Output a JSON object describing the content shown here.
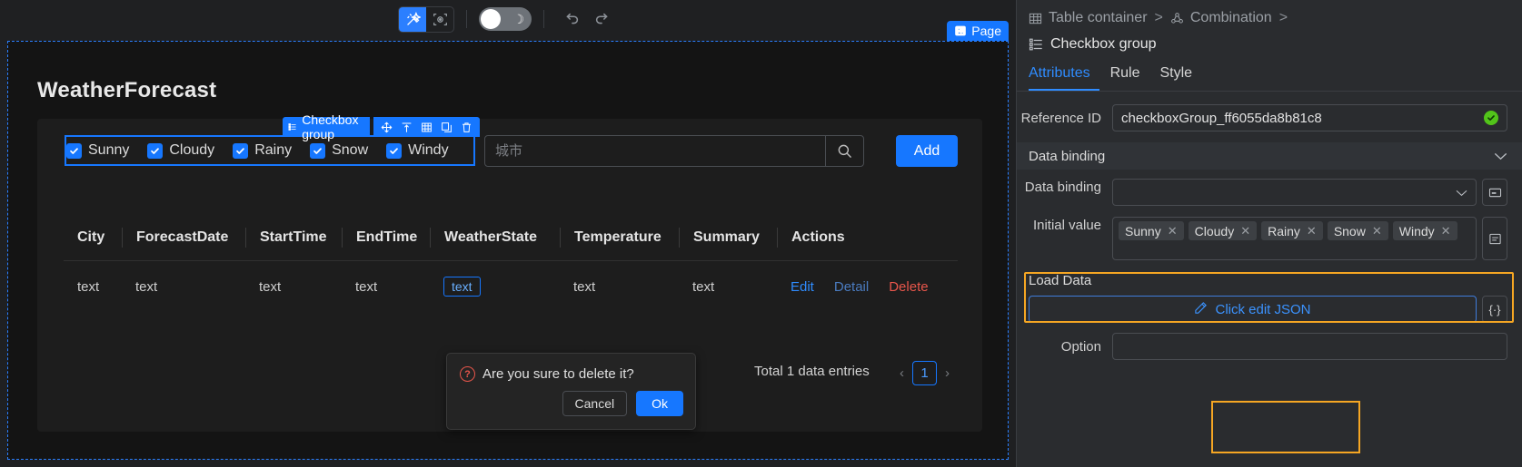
{
  "toolbar": {
    "tools": [
      {
        "name": "magic-wand-icon",
        "active": true
      },
      {
        "name": "focus-frame-icon",
        "active": false
      }
    ],
    "theme_toggle": {
      "name": "dark-mode-toggle",
      "state": "on",
      "icon": "moon-icon"
    },
    "undo_label": "undo-icon",
    "redo_label": "redo-icon"
  },
  "canvas": {
    "page_badge": "Page",
    "page_title": "WeatherForecast",
    "checkbox_group": {
      "tag_label": "Checkbox group",
      "actions": [
        "move-icon",
        "align-top-icon",
        "table-icon",
        "copy-icon",
        "delete-icon"
      ],
      "items": [
        {
          "label": "Sunny",
          "checked": true
        },
        {
          "label": "Cloudy",
          "checked": true
        },
        {
          "label": "Rainy",
          "checked": true
        },
        {
          "label": "Snow",
          "checked": true
        },
        {
          "label": "Windy",
          "checked": true
        }
      ]
    },
    "search": {
      "value": "",
      "placeholder": "城市"
    },
    "add_button": "Add",
    "table": {
      "columns": [
        "City",
        "ForecastDate",
        "StartTime",
        "EndTime",
        "WeatherState",
        "Temperature",
        "Summary",
        "Actions"
      ],
      "rows": [
        {
          "City": "text",
          "ForecastDate": "text",
          "StartTime": "text",
          "EndTime": "text",
          "WeatherState": "text",
          "Temperature": "text",
          "Summary": "text",
          "actions": [
            "Edit",
            "Detail",
            "Delete"
          ]
        }
      ]
    },
    "footer": {
      "total": "Total 1 data entries",
      "prev": "‹",
      "page": "1",
      "next": "›"
    },
    "popconfirm": {
      "message": "Are you sure to delete it?",
      "cancel": "Cancel",
      "ok": "Ok"
    }
  },
  "panel": {
    "breadcrumb": [
      {
        "icon": "table-container-icon",
        "label": "Table container"
      },
      {
        "icon": "combination-icon",
        "label": "Combination"
      }
    ],
    "breadcrumb_sep": ">",
    "current": {
      "icon": "checkbox-group-icon",
      "label": "Checkbox group"
    },
    "tabs": [
      {
        "label": "Attributes",
        "active": true
      },
      {
        "label": "Rule",
        "active": false
      },
      {
        "label": "Style",
        "active": false
      }
    ],
    "reference_id": {
      "label": "Reference ID",
      "value": "checkboxGroup_ff6055da8b81c8",
      "valid_icon": "check-circle-icon"
    },
    "data_binding_section": {
      "label": "Data binding",
      "chevron": "chevron-down-icon"
    },
    "data_binding_field": {
      "label": "Data binding",
      "value": "",
      "chevron": "chevron-down-icon",
      "side_icon": "variable-icon"
    },
    "initial_value": {
      "label": "Initial value",
      "tags": [
        "Sunny",
        "Cloudy",
        "Rainy",
        "Snow",
        "Windy"
      ],
      "remove_icon": "close-icon",
      "side_icon": "list-icon"
    },
    "load_data": {
      "label": "Load Data",
      "button_label": "Click edit JSON",
      "button_icon": "edit-icon",
      "brace_icon": "{·}"
    },
    "option": {
      "label": "Option"
    },
    "highlight_color": "#f5a623",
    "accent_color": "#1677ff"
  }
}
